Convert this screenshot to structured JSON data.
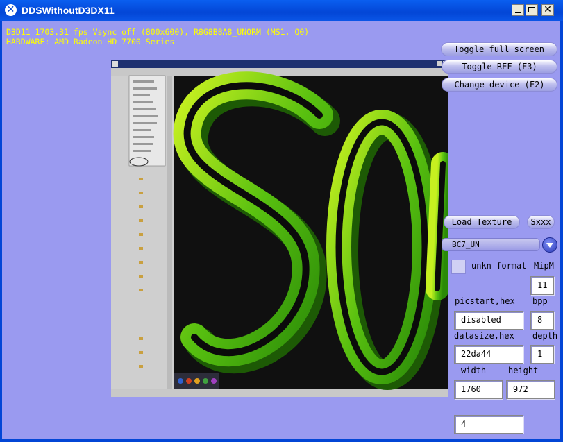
{
  "window": {
    "title": "DDSWithoutD3DX11",
    "close_glyph": "✕",
    "app_icon": "x-icon"
  },
  "stats": {
    "line1": "D3D11 1703.31 fps Vsync off (800x600), R8G8B8A8_UNORM (MS1, Q0)",
    "line2": "HARDWARE: AMD Radeon HD 7700 Series"
  },
  "buttons": {
    "toggle_fullscreen": "Toggle full screen",
    "toggle_ref": "Toggle REF (F3)",
    "change_device": "Change device (F2)",
    "load_texture": "Load Texture",
    "sxxx": "Sxxx"
  },
  "format_combo": {
    "selected": "BC7_UN"
  },
  "unkn_format": {
    "label": "unkn format",
    "checked": false
  },
  "labels": {
    "mipm": "MipM",
    "picstart": "picstart,hex",
    "bpp": "bpp",
    "datasize": "datasize,hex",
    "depth": "depth",
    "width": "width",
    "height": "height"
  },
  "fields": {
    "mipm": "11",
    "picstart": "disabled",
    "bpp": "8",
    "datasize": "22da44",
    "depth": "1",
    "width": "1760",
    "height": "972",
    "extra": "4"
  },
  "colors": {
    "accent_bg": "#9a9af0",
    "stats_text": "#ffff00",
    "titlebar": "#0346d6",
    "logo_green": "#7ad414"
  }
}
